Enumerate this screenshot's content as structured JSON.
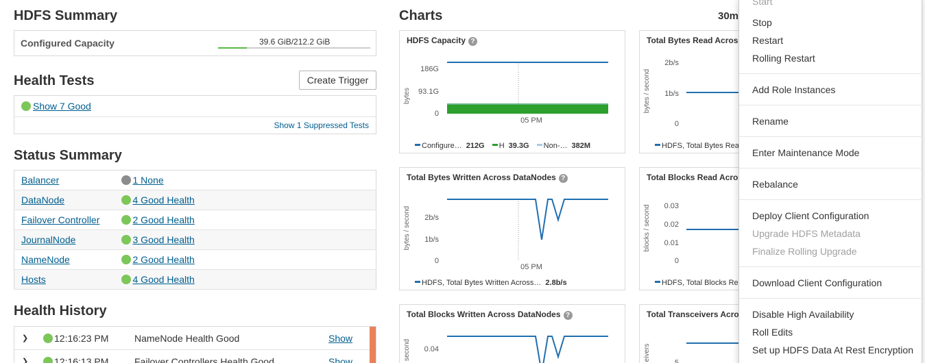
{
  "hdfs_summary": {
    "title": "HDFS Summary",
    "capacity_label": "Configured Capacity",
    "capacity_value": "39.6 GiB/212.2 GiB",
    "capacity_used_fraction": 0.187
  },
  "health_tests": {
    "title": "Health Tests",
    "create_trigger": "Create Trigger",
    "show_good": "Show 7 Good",
    "show_suppressed": "Show 1 Suppressed Tests"
  },
  "status_summary": {
    "title": "Status Summary",
    "rows": [
      {
        "name": "Balancer",
        "status": "1 None",
        "color": "#8c8c8c"
      },
      {
        "name": "DataNode",
        "status": "4 Good Health",
        "color": "#7cc65a"
      },
      {
        "name": "Failover Controller",
        "status": "2 Good Health",
        "color": "#7cc65a"
      },
      {
        "name": "JournalNode",
        "status": "3 Good Health",
        "color": "#7cc65a"
      },
      {
        "name": "NameNode",
        "status": "2 Good Health",
        "color": "#7cc65a"
      },
      {
        "name": "Hosts",
        "status": "4 Good Health",
        "color": "#7cc65a"
      }
    ]
  },
  "health_history": {
    "title": "Health History",
    "rows": [
      {
        "time": "12:16:23 PM",
        "message": "NameNode Health Good",
        "action": "Show"
      },
      {
        "time": "12:16:13 PM",
        "message": "Failover Controllers Health Good",
        "action": "Show"
      }
    ]
  },
  "charts": {
    "title": "Charts",
    "time_range": "30m",
    "panels": [
      {
        "title": "HDFS Capacity",
        "help": "?",
        "ylabel": "bytes",
        "yticks": [
          "186G",
          "93.1G",
          "0"
        ],
        "xtick": "05 PM",
        "legend": [
          {
            "label": "Configure…",
            "value": "212G",
            "color": "#1f6eb0"
          },
          {
            "label": "H",
            "value": "39.3G",
            "color": "#2c9f2c"
          },
          {
            "label": "Non-…",
            "value": "382M",
            "color": "#a6cbe6"
          }
        ]
      },
      {
        "title": "Total Bytes Read Across D",
        "ylabel": "bytes / second",
        "yticks": [
          "2b/s",
          "1b/s",
          "0"
        ],
        "legend": [
          {
            "label": "HDFS, Total Bytes Rea",
            "value": "",
            "color": "#1f6eb0"
          }
        ]
      },
      {
        "title": "Total Bytes Written Across DataNodes",
        "help": "?",
        "ylabel": "bytes / second",
        "yticks": [
          "2b/s",
          "1b/s",
          "0"
        ],
        "xtick": "05 PM",
        "legend": [
          {
            "label": "HDFS, Total Bytes Written Across…",
            "value": "2.8b/s",
            "color": "#1f6eb0"
          }
        ]
      },
      {
        "title": "Total Blocks Read Across D",
        "ylabel": "blocks / second",
        "yticks": [
          "0.03",
          "0.02",
          "0.01",
          "0"
        ],
        "legend": [
          {
            "label": "HDFS, Total Blocks Re",
            "value": "",
            "color": "#1f6eb0"
          }
        ]
      },
      {
        "title": "Total Blocks Written Across DataNodes",
        "help": "?",
        "ylabel": "second",
        "yticks": [
          "0.04"
        ]
      },
      {
        "title": "Total Transceivers Across",
        "ylabel": "eivers",
        "yticks": [
          "5"
        ]
      }
    ]
  },
  "actions_menu": {
    "items": [
      {
        "label": "Start",
        "enabled": false
      },
      {
        "label": "Stop",
        "enabled": true
      },
      {
        "label": "Restart",
        "enabled": true
      },
      {
        "label": "Rolling Restart",
        "enabled": true
      },
      {
        "label": "Add Role Instances",
        "enabled": true
      },
      {
        "label": "Rename",
        "enabled": true
      },
      {
        "label": "Enter Maintenance Mode",
        "enabled": true
      },
      {
        "label": "Rebalance",
        "enabled": true
      },
      {
        "label": "Deploy Client Configuration",
        "enabled": true
      },
      {
        "label": "Upgrade HDFS Metadata",
        "enabled": false
      },
      {
        "label": "Finalize Rolling Upgrade",
        "enabled": false
      },
      {
        "label": "Download Client Configuration",
        "enabled": true
      },
      {
        "label": "Disable High Availability",
        "enabled": true
      },
      {
        "label": "Roll Edits",
        "enabled": true
      },
      {
        "label": "Set up HDFS Data At Rest Encryption",
        "enabled": true
      }
    ]
  },
  "colors": {
    "good": "#7cc65a",
    "none": "#8c8c8c",
    "line": "#1f6eb0",
    "bar": "#2c9f2c",
    "history_accent": "#e8825a"
  }
}
